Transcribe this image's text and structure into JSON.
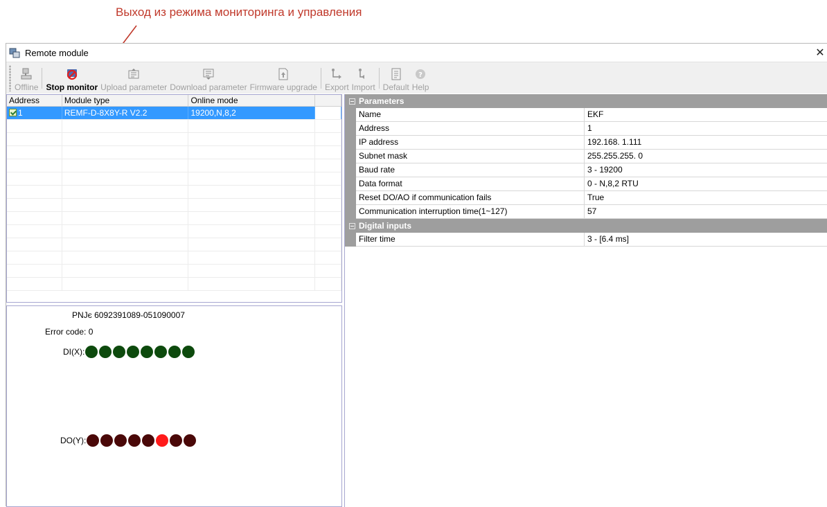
{
  "annotation": {
    "text": "Выход из режима мониторинга и управления",
    "color": "#c0392b"
  },
  "window": {
    "title": "Remote module",
    "close_glyph": "✕",
    "icon": "module-icon"
  },
  "toolbar": {
    "buttons": [
      {
        "label": "Offline",
        "icon": "computer-icon",
        "enabled": false
      },
      {
        "label": "Stop monitor",
        "icon": "stop-monitor-icon",
        "enabled": true
      },
      {
        "label": "Upload parameter",
        "icon": "upload-icon",
        "enabled": false
      },
      {
        "label": "Download parameter",
        "icon": "download-icon",
        "enabled": false
      },
      {
        "label": "Firmware upgrade",
        "icon": "firmware-icon",
        "enabled": false
      },
      {
        "label": "Export",
        "icon": "export-icon",
        "enabled": false
      },
      {
        "label": "Import",
        "icon": "import-icon",
        "enabled": false
      },
      {
        "label": "Default",
        "icon": "default-icon",
        "enabled": false
      },
      {
        "label": "Help",
        "icon": "help-icon",
        "enabled": false
      }
    ]
  },
  "module_table": {
    "columns": [
      "Address",
      "Module type",
      "Online mode"
    ],
    "rows": [
      {
        "address": "1",
        "module_type": "REMF-D-8X8Y-R V2.2",
        "online_mode": "19200,N,8,2",
        "checked": true
      }
    ]
  },
  "status": {
    "pn": "PNJє 6092391089-051090007",
    "error_code": "Error code: 0",
    "di_label": "DI(X):",
    "do_label": "DO(Y):",
    "di_states": [
      1,
      1,
      1,
      1,
      1,
      1,
      1,
      1
    ],
    "do_states": [
      0,
      0,
      0,
      0,
      0,
      1,
      0,
      0
    ],
    "colors": {
      "di_on": "#0d4a0d",
      "do_off": "#4a0808",
      "do_on": "#ff1a1a"
    }
  },
  "properties": {
    "categories": [
      {
        "name": "Parameters",
        "items": [
          {
            "name": "Name",
            "value": "EKF"
          },
          {
            "name": "Address",
            "value": "1"
          },
          {
            "name": "IP address",
            "value": "192.168.  1.111"
          },
          {
            "name": "Subnet mask",
            "value": "255.255.255.  0"
          },
          {
            "name": "Baud rate",
            "value": "3 - 19200"
          },
          {
            "name": "Data format",
            "value": "0 - N,8,2 RTU"
          },
          {
            "name": "Reset DO/AO if communication fails",
            "value": "True"
          },
          {
            "name": "Communication interruption time(1~127)",
            "value": "57"
          }
        ]
      },
      {
        "name": "Digital inputs",
        "items": [
          {
            "name": "Filter time",
            "value": "3 - [6.4 ms]"
          }
        ]
      }
    ]
  }
}
